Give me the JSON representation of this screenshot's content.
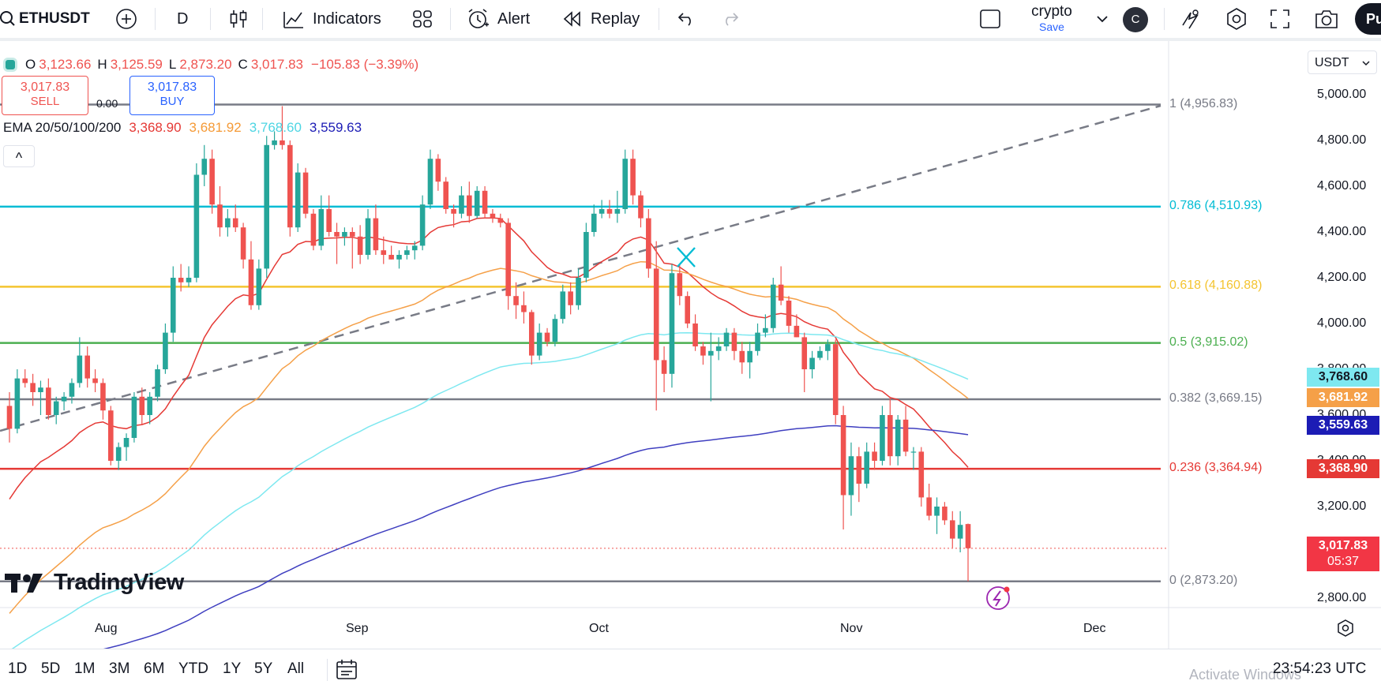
{
  "toolbar": {
    "symbol": "ETHUSDT",
    "interval": "D",
    "indicators_label": "Indicators",
    "alert_label": "Alert",
    "replay_label": "Replay",
    "layout_name": "crypto",
    "layout_save": "Save",
    "avatar_letter": "C",
    "publish_label": "Pu"
  },
  "legend": {
    "ohlc": {
      "o_label": "O",
      "o": "3,123.66",
      "h_label": "H",
      "h": "3,125.59",
      "l_label": "L",
      "l": "2,873.20",
      "c_label": "C",
      "c": "3,017.83",
      "change": "−105.83 (−3.39%)"
    },
    "sell_price": "3,017.83",
    "sell_label": "SELL",
    "spread": "0.00",
    "buy_price": "3,017.83",
    "buy_label": "BUY",
    "ema_label": "EMA 20/50/100/200",
    "ema20": "3,368.90",
    "ema50": "3,681.92",
    "ema100": "3,768.60",
    "ema200": "3,559.63",
    "collapse_glyph": "^"
  },
  "currency_select": "USDT",
  "colors": {
    "up": "#26a69a",
    "down": "#ef5350",
    "ema20": "#e53935",
    "ema50": "#f5a048",
    "ema100": "#7ee8f0",
    "ema200": "#3f3fc0",
    "fib_1": "#787b86",
    "fib_0786": "#00bcd4",
    "fib_0618": "#f4c430",
    "fib_05": "#4caf50",
    "fib_0382": "#787b86",
    "fib_0236": "#e53935",
    "fib_0": "#787b86"
  },
  "fib_levels": [
    {
      "label": "1 (4,956.83)",
      "value": 4956.83
    },
    {
      "label": "0.786 (4,510.93)",
      "value": 4510.93
    },
    {
      "label": "0.618 (4,160.88)",
      "value": 4160.88
    },
    {
      "label": "0.5 (3,915.02)",
      "value": 3915.02
    },
    {
      "label": "0.382 (3,669.15)",
      "value": 3669.15
    },
    {
      "label": "0.236 (3,364.94)",
      "value": 3364.94
    },
    {
      "label": "0 (2,873.20)",
      "value": 2873.2
    }
  ],
  "price_scale": {
    "ticks": [
      "5,000.00",
      "4,800.00",
      "4,600.00",
      "4,400.00",
      "4,200.00",
      "4,000.00",
      "3,800.00",
      "3,600.00",
      "3,400.00",
      "3,200.00",
      "2,800.00"
    ],
    "labels": {
      "ema100": "3,768.60",
      "ema50": "3,681.92",
      "ema200": "3,559.63",
      "ema20": "3,368.90",
      "last_price": "3,017.83",
      "countdown": "05:37"
    }
  },
  "time_scale": {
    "ticks": [
      "Aug",
      "Sep",
      "Oct",
      "Nov",
      "Dec"
    ]
  },
  "watermark": "TradingView",
  "bottom": {
    "ranges": [
      "1D",
      "5D",
      "1M",
      "3M",
      "6M",
      "YTD",
      "1Y",
      "5Y",
      "All"
    ],
    "clock": "23:54:23 UTC",
    "activate_windows": "Activate Windows"
  },
  "chart_data": {
    "type": "candlestick",
    "symbol": "ETHUSDT",
    "interval": "1D",
    "ylim": [
      2780,
      5060
    ],
    "candles_ohlc": [
      [
        3640,
        3700,
        3480,
        3540
      ],
      [
        3540,
        3800,
        3520,
        3760
      ],
      [
        3760,
        3800,
        3720,
        3740
      ],
      [
        3740,
        3780,
        3640,
        3700
      ],
      [
        3700,
        3750,
        3600,
        3720
      ],
      [
        3720,
        3760,
        3580,
        3600
      ],
      [
        3600,
        3680,
        3560,
        3660
      ],
      [
        3660,
        3700,
        3620,
        3680
      ],
      [
        3680,
        3760,
        3650,
        3740
      ],
      [
        3740,
        3940,
        3720,
        3860
      ],
      [
        3860,
        3900,
        3720,
        3760
      ],
      [
        3760,
        3800,
        3700,
        3740
      ],
      [
        3740,
        3760,
        3580,
        3620
      ],
      [
        3620,
        3640,
        3380,
        3400
      ],
      [
        3400,
        3480,
        3360,
        3460
      ],
      [
        3460,
        3520,
        3400,
        3500
      ],
      [
        3500,
        3700,
        3480,
        3680
      ],
      [
        3680,
        3720,
        3560,
        3600
      ],
      [
        3600,
        3700,
        3560,
        3680
      ],
      [
        3680,
        3820,
        3660,
        3800
      ],
      [
        3800,
        4000,
        3780,
        3960
      ],
      [
        3960,
        4250,
        3920,
        4200
      ],
      [
        4200,
        4260,
        4140,
        4180
      ],
      [
        4180,
        4250,
        4160,
        4200
      ],
      [
        4200,
        4700,
        4180,
        4650
      ],
      [
        4650,
        4780,
        4600,
        4720
      ],
      [
        4720,
        4760,
        4480,
        4520
      ],
      [
        4520,
        4600,
        4380,
        4420
      ],
      [
        4420,
        4500,
        4380,
        4460
      ],
      [
        4460,
        4520,
        4400,
        4420
      ],
      [
        4420,
        4440,
        4240,
        4280
      ],
      [
        4280,
        4360,
        4060,
        4080
      ],
      [
        4080,
        4280,
        4060,
        4240
      ],
      [
        4240,
        4820,
        4200,
        4780
      ],
      [
        4780,
        4840,
        4760,
        4800
      ],
      [
        4800,
        4950,
        4760,
        4780
      ],
      [
        4780,
        4800,
        4380,
        4420
      ],
      [
        4420,
        4700,
        4400,
        4660
      ],
      [
        4660,
        4680,
        4460,
        4480
      ],
      [
        4480,
        4500,
        4320,
        4340
      ],
      [
        4340,
        4560,
        4320,
        4500
      ],
      [
        4500,
        4560,
        4380,
        4400
      ],
      [
        4400,
        4440,
        4260,
        4380
      ],
      [
        4380,
        4420,
        4340,
        4400
      ],
      [
        4400,
        4420,
        4240,
        4380
      ],
      [
        4380,
        4430,
        4260,
        4300
      ],
      [
        4300,
        4500,
        4280,
        4460
      ],
      [
        4460,
        4520,
        4300,
        4320
      ],
      [
        4320,
        4380,
        4260,
        4300
      ],
      [
        4300,
        4340,
        4280,
        4280
      ],
      [
        4280,
        4320,
        4240,
        4300
      ],
      [
        4300,
        4340,
        4280,
        4320
      ],
      [
        4320,
        4360,
        4280,
        4340
      ],
      [
        4340,
        4560,
        4320,
        4520
      ],
      [
        4520,
        4760,
        4500,
        4720
      ],
      [
        4720,
        4740,
        4580,
        4620
      ],
      [
        4620,
        4640,
        4480,
        4500
      ],
      [
        4500,
        4520,
        4420,
        4480
      ],
      [
        4480,
        4600,
        4460,
        4560
      ],
      [
        4560,
        4620,
        4440,
        4470
      ],
      [
        4470,
        4600,
        4460,
        4580
      ],
      [
        4580,
        4600,
        4460,
        4480
      ],
      [
        4480,
        4500,
        4440,
        4460
      ],
      [
        4460,
        4480,
        4420,
        4440
      ],
      [
        4440,
        4460,
        4060,
        4120
      ],
      [
        4120,
        4180,
        4020,
        4080
      ],
      [
        4080,
        4140,
        4000,
        4050
      ],
      [
        4050,
        4060,
        3820,
        3860
      ],
      [
        3860,
        4000,
        3840,
        3960
      ],
      [
        3960,
        3980,
        3900,
        3920
      ],
      [
        3920,
        4040,
        3900,
        4020
      ],
      [
        4020,
        4170,
        4000,
        4140
      ],
      [
        4140,
        4180,
        4040,
        4080
      ],
      [
        4080,
        4240,
        4060,
        4200
      ],
      [
        4200,
        4440,
        4180,
        4400
      ],
      [
        4400,
        4520,
        4380,
        4480
      ],
      [
        4480,
        4540,
        4460,
        4500
      ],
      [
        4500,
        4540,
        4460,
        4480
      ],
      [
        4480,
        4580,
        4440,
        4500
      ],
      [
        4500,
        4760,
        4480,
        4720
      ],
      [
        4720,
        4760,
        4520,
        4560
      ],
      [
        4560,
        4580,
        4420,
        4460
      ],
      [
        4460,
        4500,
        4200,
        4240
      ],
      [
        4240,
        4360,
        3620,
        3840
      ],
      [
        3840,
        3900,
        3700,
        3780
      ],
      [
        3780,
        4260,
        3720,
        4220
      ],
      [
        4220,
        4260,
        4080,
        4120
      ],
      [
        4120,
        4140,
        3980,
        4000
      ],
      [
        4000,
        4040,
        3880,
        3900
      ],
      [
        3900,
        3920,
        3820,
        3860
      ],
      [
        3860,
        3960,
        3660,
        3880
      ],
      [
        3880,
        3940,
        3840,
        3900
      ],
      [
        3900,
        3980,
        3880,
        3960
      ],
      [
        3960,
        3980,
        3840,
        3880
      ],
      [
        3880,
        3920,
        3780,
        3830
      ],
      [
        3830,
        3920,
        3760,
        3880
      ],
      [
        3880,
        4000,
        3860,
        3960
      ],
      [
        3960,
        4040,
        3940,
        3980
      ],
      [
        3980,
        4200,
        3960,
        4170
      ],
      [
        4170,
        4250,
        4080,
        4100
      ],
      [
        4100,
        4120,
        3960,
        3990
      ],
      [
        3990,
        4040,
        3940,
        3940
      ],
      [
        3940,
        3960,
        3700,
        3800
      ],
      [
        3800,
        3880,
        3760,
        3850
      ],
      [
        3850,
        3900,
        3840,
        3880
      ],
      [
        3880,
        3930,
        3840,
        3910
      ],
      [
        3910,
        3930,
        3560,
        3600
      ],
      [
        3600,
        3640,
        3100,
        3250
      ],
      [
        3250,
        3480,
        3160,
        3420
      ],
      [
        3420,
        3460,
        3220,
        3300
      ],
      [
        3300,
        3480,
        3280,
        3440
      ],
      [
        3440,
        3480,
        3360,
        3400
      ],
      [
        3400,
        3640,
        3380,
        3600
      ],
      [
        3600,
        3680,
        3380,
        3420
      ],
      [
        3420,
        3600,
        3380,
        3580
      ],
      [
        3580,
        3640,
        3420,
        3440
      ],
      [
        3440,
        3460,
        3360,
        3440
      ],
      [
        3440,
        3460,
        3200,
        3240
      ],
      [
        3240,
        3300,
        3140,
        3160
      ],
      [
        3160,
        3240,
        3080,
        3200
      ],
      [
        3200,
        3220,
        3120,
        3140
      ],
      [
        3140,
        3180,
        3020,
        3060
      ],
      [
        3060,
        3180,
        3000,
        3120
      ],
      [
        3123.66,
        3125.59,
        2873.2,
        3017.83
      ]
    ]
  }
}
